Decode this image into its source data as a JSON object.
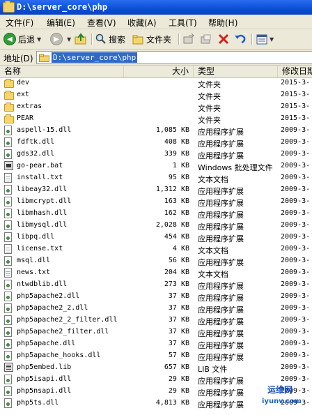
{
  "window": {
    "title": "D:\\server_core\\php"
  },
  "menu": [
    "文件(F)",
    "编辑(E)",
    "查看(V)",
    "收藏(A)",
    "工具(T)",
    "帮助(H)"
  ],
  "toolbar": {
    "back_label": "后退",
    "search_label": "搜索",
    "folders_label": "文件夹"
  },
  "address": {
    "label": "地址(D)",
    "value": "D:\\server_core\\php"
  },
  "columns": {
    "name": "名称",
    "size": "大小",
    "type": "类型",
    "modified": "修改日期"
  },
  "files": [
    {
      "name": "dev",
      "size": "",
      "type": "文件夹",
      "date": "2015-3-",
      "icon": "folder-icon"
    },
    {
      "name": "ext",
      "size": "",
      "type": "文件夹",
      "date": "2015-3-",
      "icon": "folder-icon"
    },
    {
      "name": "extras",
      "size": "",
      "type": "文件夹",
      "date": "2015-3-",
      "icon": "folder-icon"
    },
    {
      "name": "PEAR",
      "size": "",
      "type": "文件夹",
      "date": "2015-3-",
      "icon": "folder-icon"
    },
    {
      "name": "aspell-15.dll",
      "size": "1,085 KB",
      "type": "应用程序扩展",
      "date": "2009-3-",
      "icon": "dll-icon"
    },
    {
      "name": "fdftk.dll",
      "size": "408 KB",
      "type": "应用程序扩展",
      "date": "2009-3-",
      "icon": "dll-icon"
    },
    {
      "name": "gds32.dll",
      "size": "339 KB",
      "type": "应用程序扩展",
      "date": "2009-3-",
      "icon": "dll-icon"
    },
    {
      "name": "go-pear.bat",
      "size": "1 KB",
      "type": "Windows 批处理文件",
      "date": "2009-3-",
      "icon": "bat-icon"
    },
    {
      "name": "install.txt",
      "size": "95 KB",
      "type": "文本文档",
      "date": "2009-3-",
      "icon": "txt-icon"
    },
    {
      "name": "libeay32.dll",
      "size": "1,312 KB",
      "type": "应用程序扩展",
      "date": "2009-3-",
      "icon": "dll-icon"
    },
    {
      "name": "libmcrypt.dll",
      "size": "163 KB",
      "type": "应用程序扩展",
      "date": "2009-3-",
      "icon": "dll-icon"
    },
    {
      "name": "libmhash.dll",
      "size": "162 KB",
      "type": "应用程序扩展",
      "date": "2009-3-",
      "icon": "dll-icon"
    },
    {
      "name": "libmysql.dll",
      "size": "2,028 KB",
      "type": "应用程序扩展",
      "date": "2009-3-",
      "icon": "dll-icon"
    },
    {
      "name": "libpq.dll",
      "size": "454 KB",
      "type": "应用程序扩展",
      "date": "2009-3-",
      "icon": "dll-icon"
    },
    {
      "name": "license.txt",
      "size": "4 KB",
      "type": "文本文档",
      "date": "2009-3-",
      "icon": "txt-icon"
    },
    {
      "name": "msql.dll",
      "size": "56 KB",
      "type": "应用程序扩展",
      "date": "2009-3-",
      "icon": "dll-icon"
    },
    {
      "name": "news.txt",
      "size": "204 KB",
      "type": "文本文档",
      "date": "2009-3-",
      "icon": "txt-icon"
    },
    {
      "name": "ntwdblib.dll",
      "size": "273 KB",
      "type": "应用程序扩展",
      "date": "2009-3-",
      "icon": "dll-icon"
    },
    {
      "name": "php5apache2.dll",
      "size": "37 KB",
      "type": "应用程序扩展",
      "date": "2009-3-",
      "icon": "dll-icon"
    },
    {
      "name": "php5apache2_2.dll",
      "size": "37 KB",
      "type": "应用程序扩展",
      "date": "2009-3-",
      "icon": "dll-icon"
    },
    {
      "name": "php5apache2_2_filter.dll",
      "size": "37 KB",
      "type": "应用程序扩展",
      "date": "2009-3-",
      "icon": "dll-icon"
    },
    {
      "name": "php5apache2_filter.dll",
      "size": "37 KB",
      "type": "应用程序扩展",
      "date": "2009-3-",
      "icon": "dll-icon"
    },
    {
      "name": "php5apache.dll",
      "size": "37 KB",
      "type": "应用程序扩展",
      "date": "2009-3-",
      "icon": "dll-icon"
    },
    {
      "name": "php5apache_hooks.dll",
      "size": "57 KB",
      "type": "应用程序扩展",
      "date": "2009-3-",
      "icon": "dll-icon"
    },
    {
      "name": "php5embed.lib",
      "size": "657 KB",
      "type": "LIB 文件",
      "date": "2009-3-",
      "icon": "lib-icon"
    },
    {
      "name": "php5isapi.dll",
      "size": "29 KB",
      "type": "应用程序扩展",
      "date": "2009-3-",
      "icon": "dll-icon"
    },
    {
      "name": "php5nsapi.dll",
      "size": "29 KB",
      "type": "应用程序扩展",
      "date": "2009-3-",
      "icon": "dll-icon"
    },
    {
      "name": "php5ts.dll",
      "size": "4,813 KB",
      "type": "应用程序扩展",
      "date": "2009-3-",
      "icon": "dll-icon"
    }
  ],
  "watermark": {
    "line1": "运维网",
    "line2": "iyunv.com"
  },
  "colors": {
    "titlebar": "#0a4fd6",
    "selection": "#316ac5",
    "chrome": "#ece9d8"
  }
}
